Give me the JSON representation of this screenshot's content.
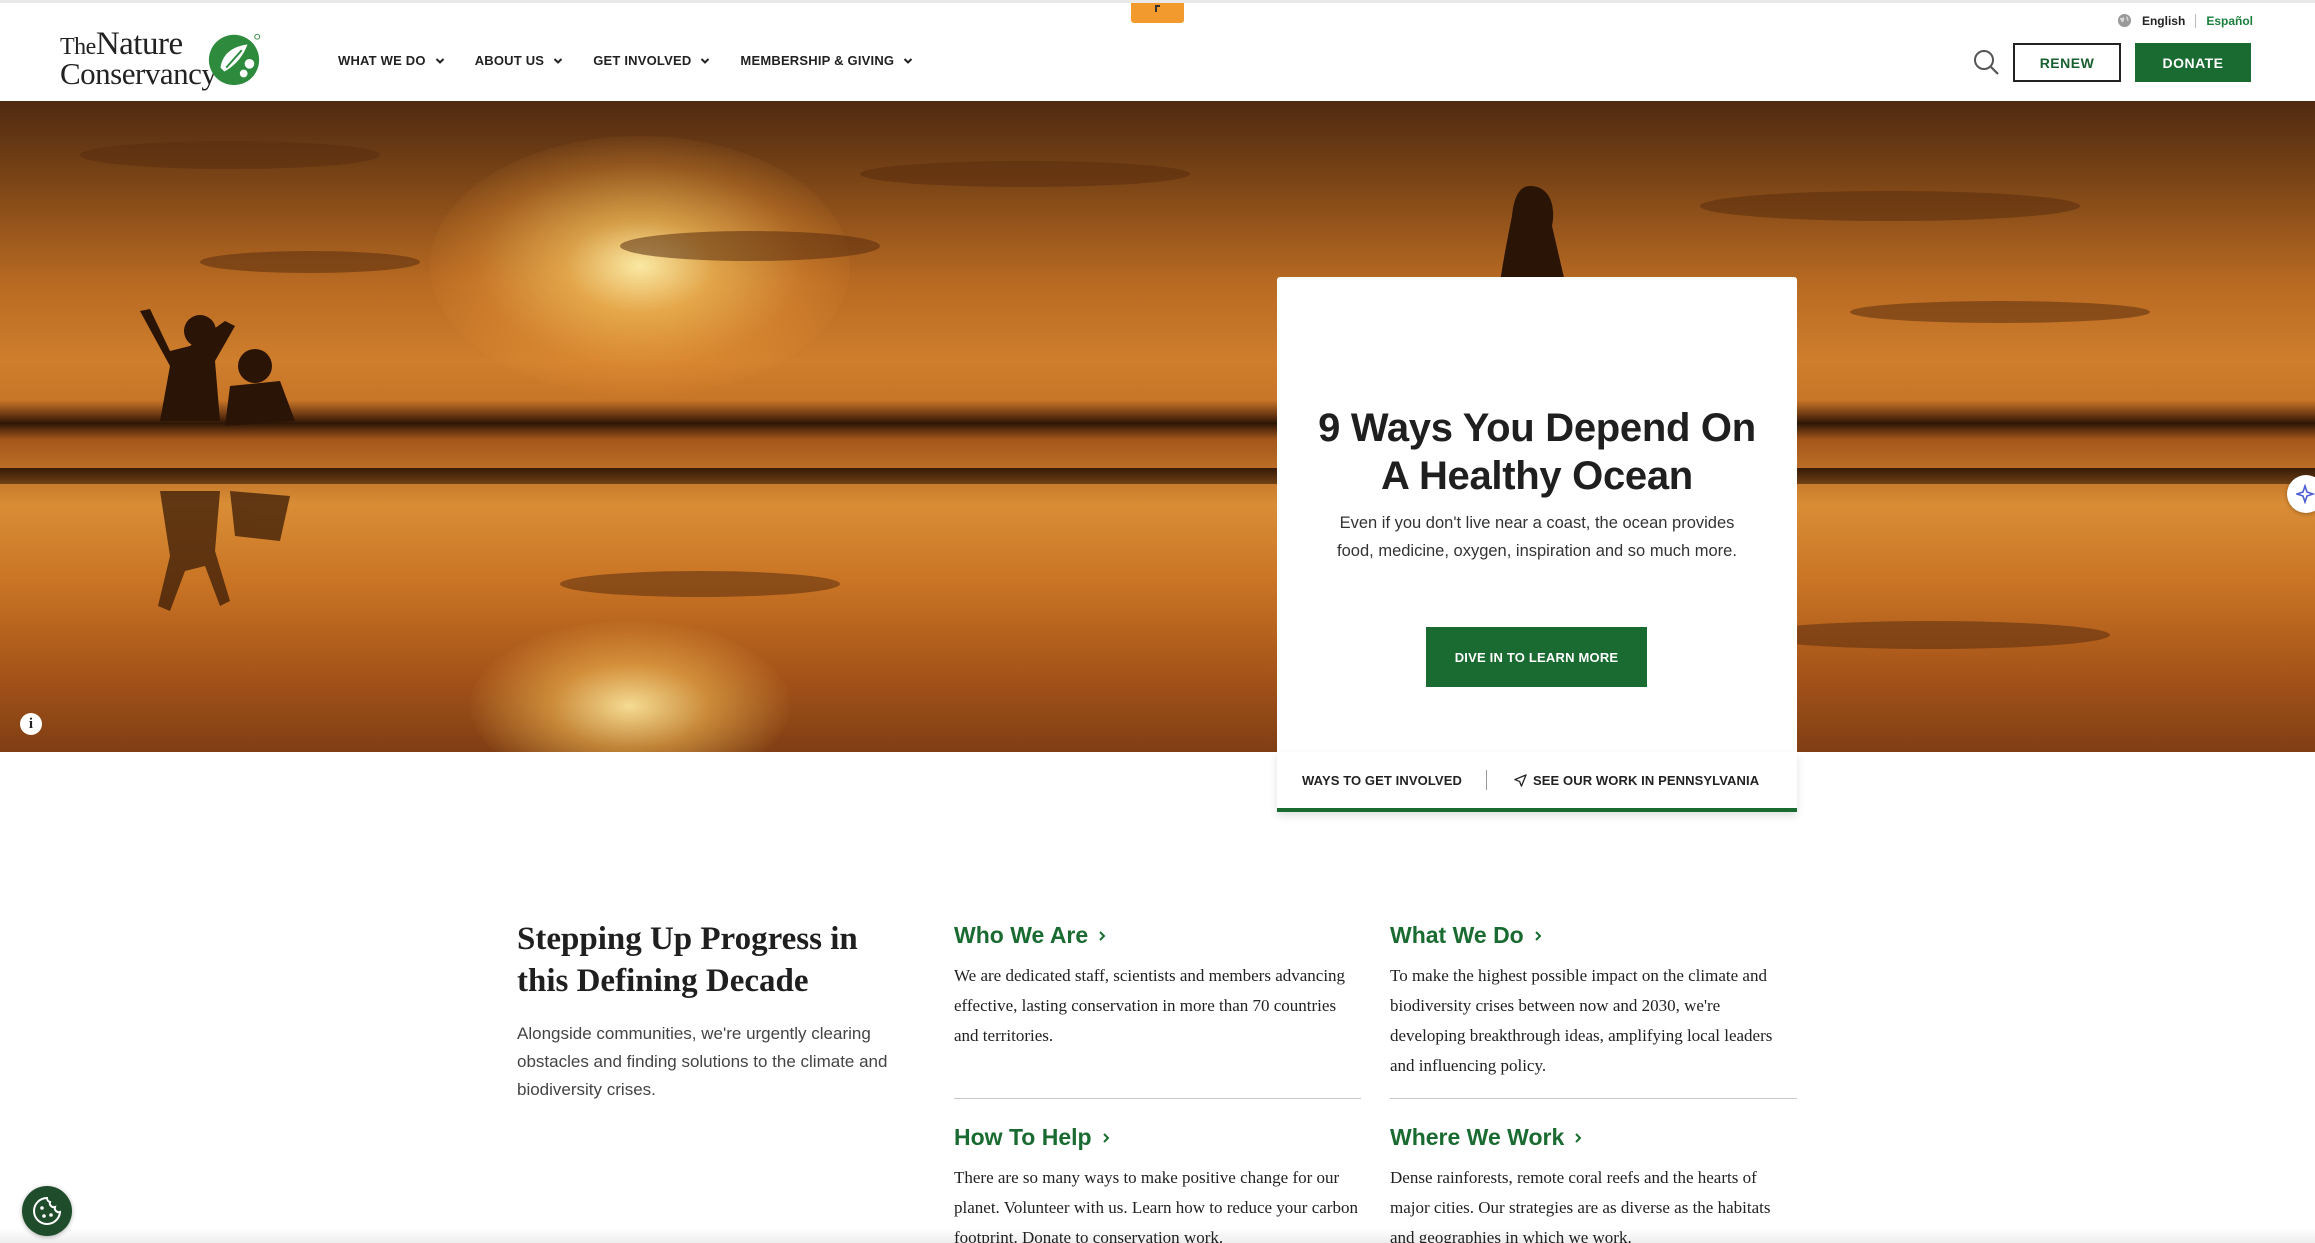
{
  "header": {
    "logo": {
      "line1_small": "The",
      "line1": "Nature",
      "line2": "Conservancy"
    },
    "nav": [
      {
        "label": "WHAT WE DO"
      },
      {
        "label": "ABOUT US"
      },
      {
        "label": "GET INVOLVED"
      },
      {
        "label": "MEMBERSHIP & GIVING"
      }
    ],
    "language": {
      "current": "English",
      "alternate": "Español"
    },
    "renew_label": "RENEW",
    "donate_label": "DONATE"
  },
  "hero": {
    "card": {
      "title": "9 Ways You Depend On A Healthy Ocean",
      "body": "Even if you don't live near a coast, the ocean provides food, medicine, oxygen, inspiration and so much more.",
      "cta": "DIVE IN TO LEARN MORE"
    },
    "links": {
      "ways": "WAYS TO GET INVOLVED",
      "work": "SEE OUR WORK IN PENNSYLVANIA"
    },
    "info_glyph": "i"
  },
  "intro": {
    "title": "Stepping Up Progress in this Defining Decade",
    "body": "Alongside communities, we're urgently clearing obstacles and finding solutions to the climate and biodiversity crises."
  },
  "sections": [
    {
      "title": "Who We Are",
      "text": "We are dedicated staff, scientists and members advancing effective, lasting conservation in more than 70 countries and territories."
    },
    {
      "title": "What We Do",
      "text": "To make the highest possible impact on the climate and biodiversity crises between now and 2030, we're developing breakthrough ideas, amplifying local leaders and influencing policy."
    },
    {
      "title": "How To Help",
      "text": "There are so many ways to make positive change for our planet. Volunteer with us. Learn how to reduce your carbon footprint. Donate to conservation work."
    },
    {
      "title": "Where We Work",
      "text": "Dense rainforests, remote coral reefs and the hearts of major cities. Our strategies are as diverse as the habitats and geographies in which we work."
    }
  ],
  "colors": {
    "brand_green": "#1a6b31",
    "link_green": "#1a7f3c",
    "feedback_orange": "#f29a2e"
  }
}
